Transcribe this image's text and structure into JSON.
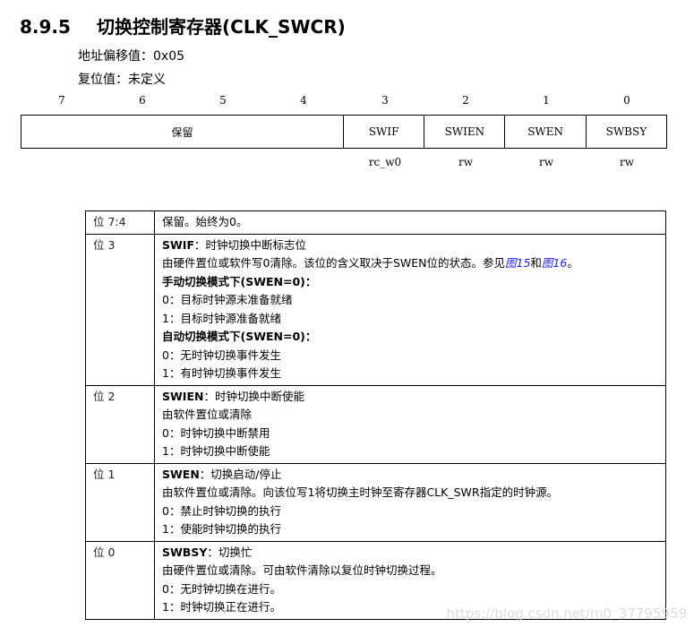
{
  "section": {
    "number": "8.9.5",
    "title": "切换控制寄存器(CLK_SWCR)"
  },
  "address_offset": "地址偏移值：0x05",
  "reset_value": "复位值：未定义",
  "bits": [
    "7",
    "6",
    "5",
    "4",
    "3",
    "2",
    "1",
    "0"
  ],
  "fields": [
    "保留",
    "SWIF",
    "SWIEN",
    "SWEN",
    "SWBSY"
  ],
  "access": [
    "rc_w0",
    "rw",
    "rw",
    "rw"
  ],
  "rows": [
    {
      "bit": "位 7:4",
      "lines": [
        {
          "text": "保留。始终为0。"
        }
      ]
    },
    {
      "bit": "位 3",
      "head": "SWIF",
      "head_desc": "：时钟切换中断标志位",
      "desc": "由硬件置位或软件写0清除。该位的含义取决于SWEN位的状态。参见",
      "link1": "图15",
      "and": "和",
      "link2": "图16",
      "end": "。",
      "sub1": "手动切换模式下(SWEN=0)：",
      "l1": "0：目标时钟源未准备就绪",
      "l2": "1：目标时钟源准备就绪",
      "sub2": "自动切换模式下(SWEN=0)：",
      "l3": "0：无时钟切换事件发生",
      "l4": "1：有时钟切换事件发生"
    },
    {
      "bit": "位 2",
      "head": "SWIEN",
      "head_desc": "：时钟切换中断使能",
      "l1": "由软件置位或清除",
      "l2": "0：时钟切换中断禁用",
      "l3": "1：时钟切换中断使能"
    },
    {
      "bit": "位 1",
      "head": "SWEN",
      "head_desc": "：切换启动/停止",
      "l1": "由软件置位或清除。向该位写1将切换主时钟至寄存器CLK_SWR指定的时钟源。",
      "l2": "0：禁止时钟切换的执行",
      "l3": "1：使能时钟切换的执行"
    },
    {
      "bit": "位 0",
      "head": "SWBSY",
      "head_desc": "：切换忙",
      "l1": "由硬件置位或清除。可由软件清除以复位时钟切换过程。",
      "l2": "0：无时钟切换在进行。",
      "l3": "1：时钟切换正在进行。"
    }
  ],
  "watermark": "https://blog.csdn.net/m0_37795959"
}
